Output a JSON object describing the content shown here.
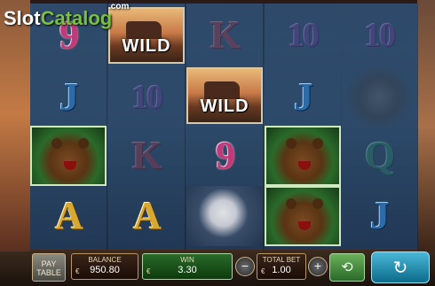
{
  "brand": {
    "logo_part1": "Slot",
    "logo_part2": "Catalog",
    "logo_suffix": ".com"
  },
  "reels": [
    [
      "9",
      "J",
      "bear",
      "A"
    ],
    [
      "WILD",
      "10",
      "K",
      "A"
    ],
    [
      "K",
      "WILD",
      "9",
      "eagle"
    ],
    [
      "10",
      "J",
      "bear",
      "bear"
    ],
    [
      "10",
      "bison",
      "Q",
      "J"
    ]
  ],
  "controls": {
    "paytable_label_1": "PAY",
    "paytable_label_2": "TABLE",
    "balance_label": "BALANCE",
    "balance_value": "950.80",
    "win_label": "WIN",
    "win_value": "3.30",
    "total_bet_label": "TOTAL BET",
    "total_bet_value": "1.00",
    "currency_symbol": "€",
    "bet_minus": "−",
    "bet_plus": "+"
  },
  "colors": {
    "win_panel": "#2a6a2a",
    "spin_button": "#1a98c0",
    "autoplay_button": "#4a9a3a"
  },
  "icons": {
    "spin": "circular-arrow",
    "autoplay": "refresh-arrows"
  }
}
